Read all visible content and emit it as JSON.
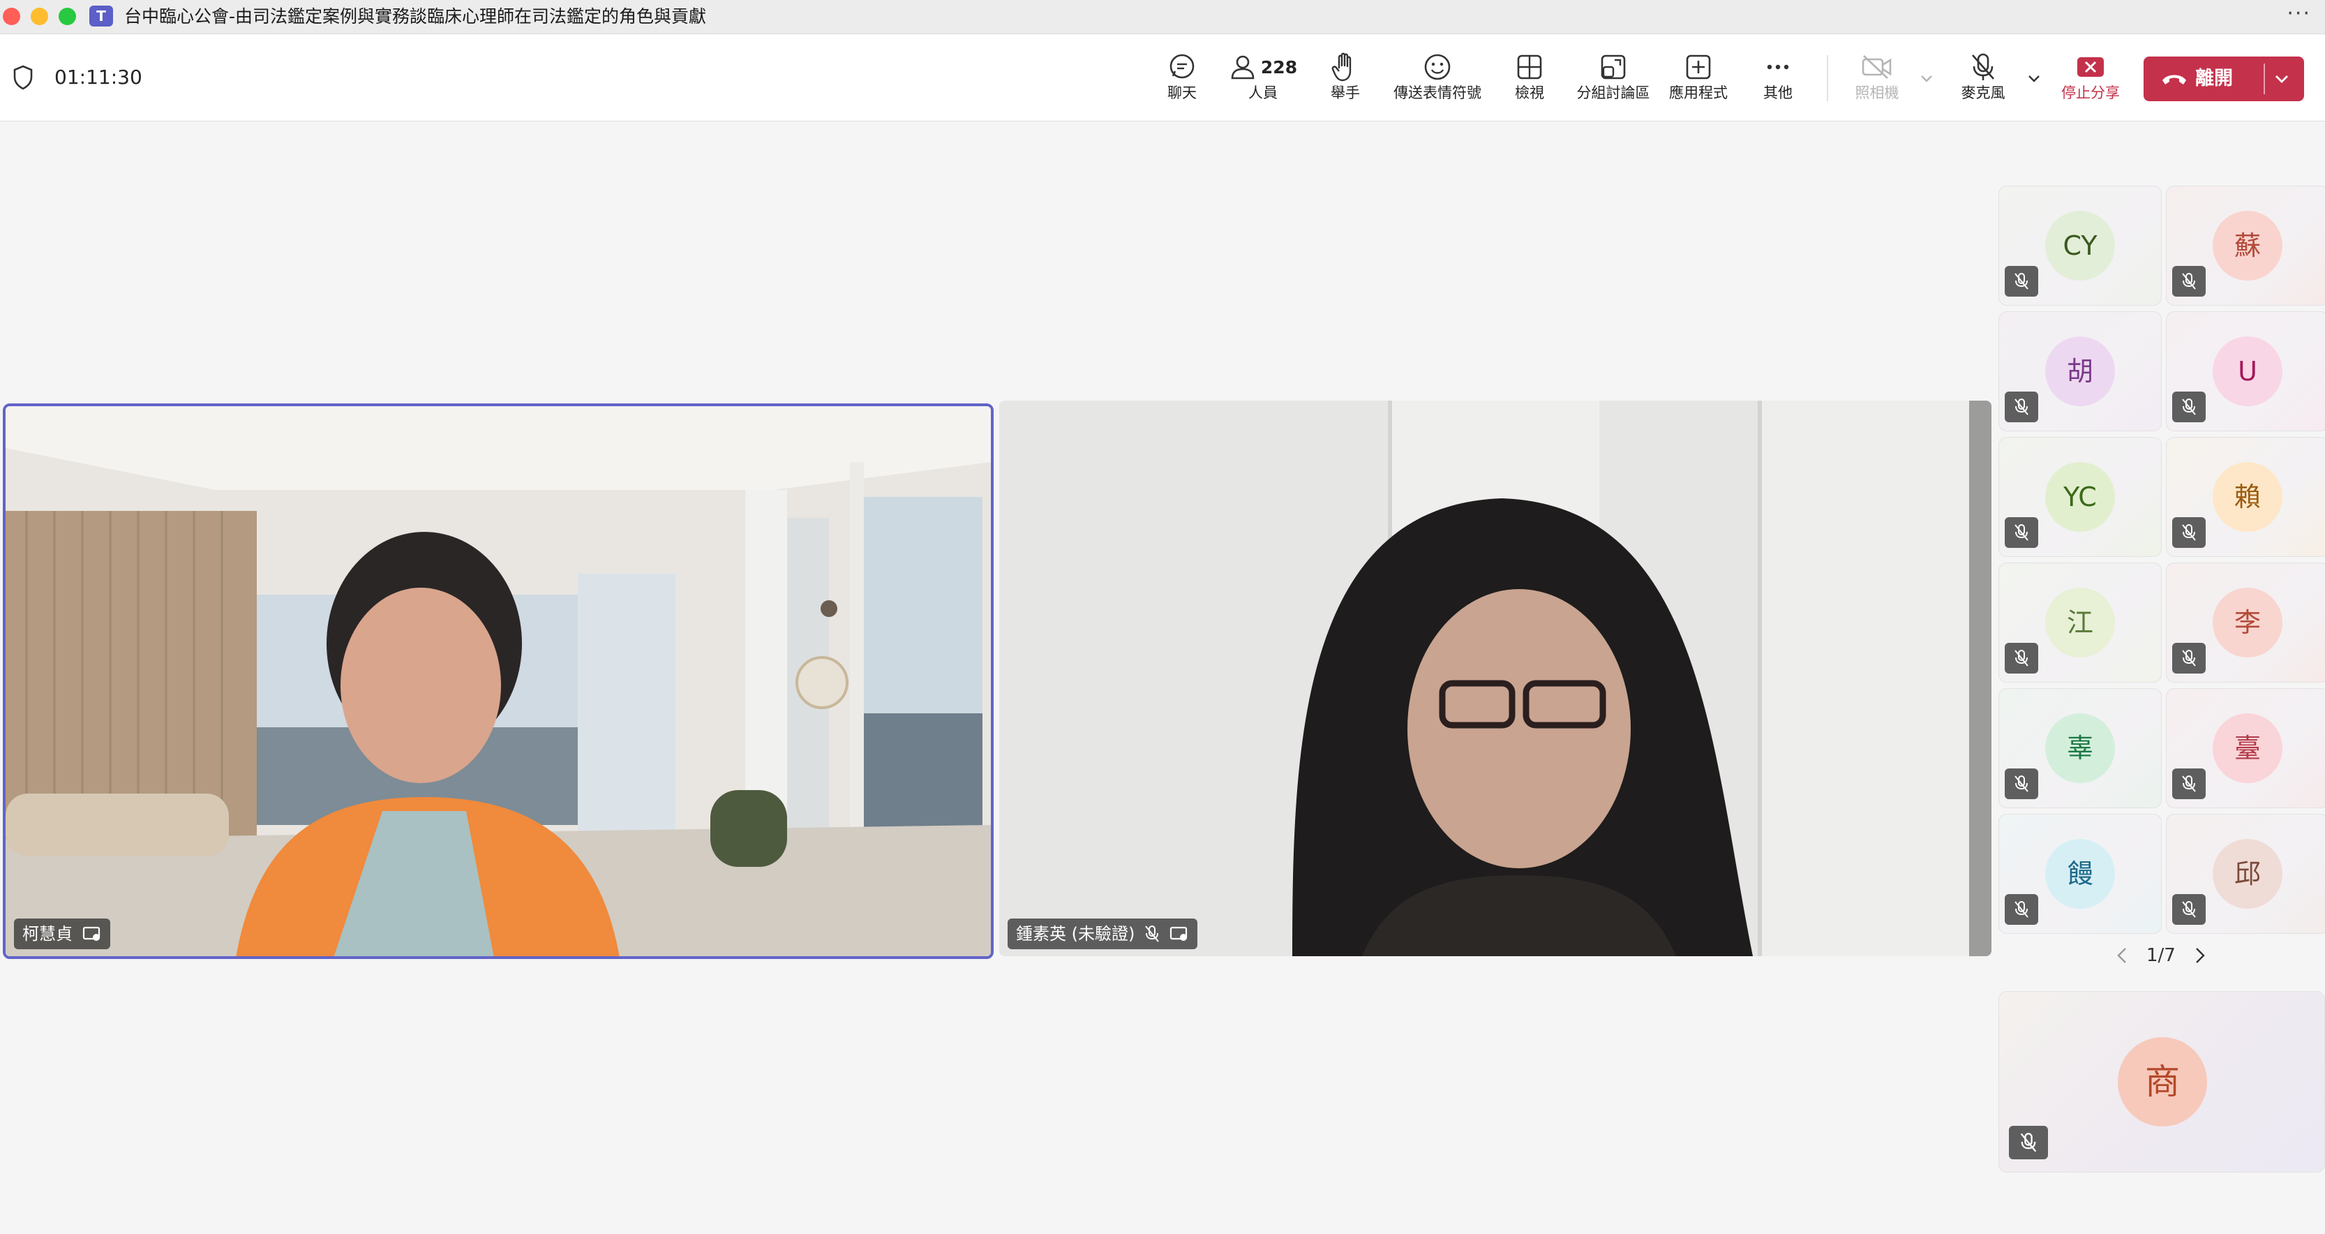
{
  "window": {
    "title": "台中臨心公會-由司法鑑定案例與實務談臨床心理師在司法鑑定的角色與貢獻",
    "more": "···"
  },
  "toolbar": {
    "timer": "01:11:30",
    "chat_label": "聊天",
    "people_label": "人員",
    "people_count": "228",
    "raise_hand_label": "舉手",
    "reactions_label": "傳送表情符號",
    "view_label": "檢視",
    "breakout_label": "分組討論區",
    "apps_label": "應用程式",
    "more_label": "其他",
    "camera_label": "照相機",
    "mic_label": "麥克風",
    "stop_share_label": "停止分享",
    "leave_label": "離開"
  },
  "stage": {
    "participants": [
      {
        "name": "柯慧貞"
      },
      {
        "name": "鍾素英 (未驗證)"
      }
    ]
  },
  "gallery": {
    "tiles": [
      {
        "initials": "CY",
        "bg": "#e3eed9",
        "fg": "#3a5a1e"
      },
      {
        "initials": "蘇",
        "bg": "#f9d4cf",
        "fg": "#b24a3a"
      },
      {
        "initials": "胡",
        "bg": "#edd8f1",
        "fg": "#7a3a8a"
      },
      {
        "initials": "U",
        "bg": "#f9d6e6",
        "fg": "#a21a5a"
      },
      {
        "initials": "YC",
        "bg": "#e2efcf",
        "fg": "#3b6a1a"
      },
      {
        "initials": "賴",
        "bg": "#fde7c8",
        "fg": "#9a5a10"
      },
      {
        "initials": "江",
        "bg": "#e8f0d6",
        "fg": "#5a7a3a"
      },
      {
        "initials": "李",
        "bg": "#f9d5cf",
        "fg": "#b24a3a"
      },
      {
        "initials": "辜",
        "bg": "#d3efdc",
        "fg": "#1e7a44"
      },
      {
        "initials": "臺",
        "bg": "#f9d4d8",
        "fg": "#b23a4a"
      },
      {
        "initials": "饅",
        "bg": "#d6eff5",
        "fg": "#1e6a8a"
      },
      {
        "initials": "邱",
        "bg": "#f0dcd6",
        "fg": "#7a4a3a"
      }
    ],
    "pager": {
      "text": "1/7"
    },
    "featured": {
      "initials": "商"
    }
  },
  "colors": {
    "accent": "#6264c8",
    "leave": "#c4314b",
    "stop_share": "#c4314b"
  }
}
